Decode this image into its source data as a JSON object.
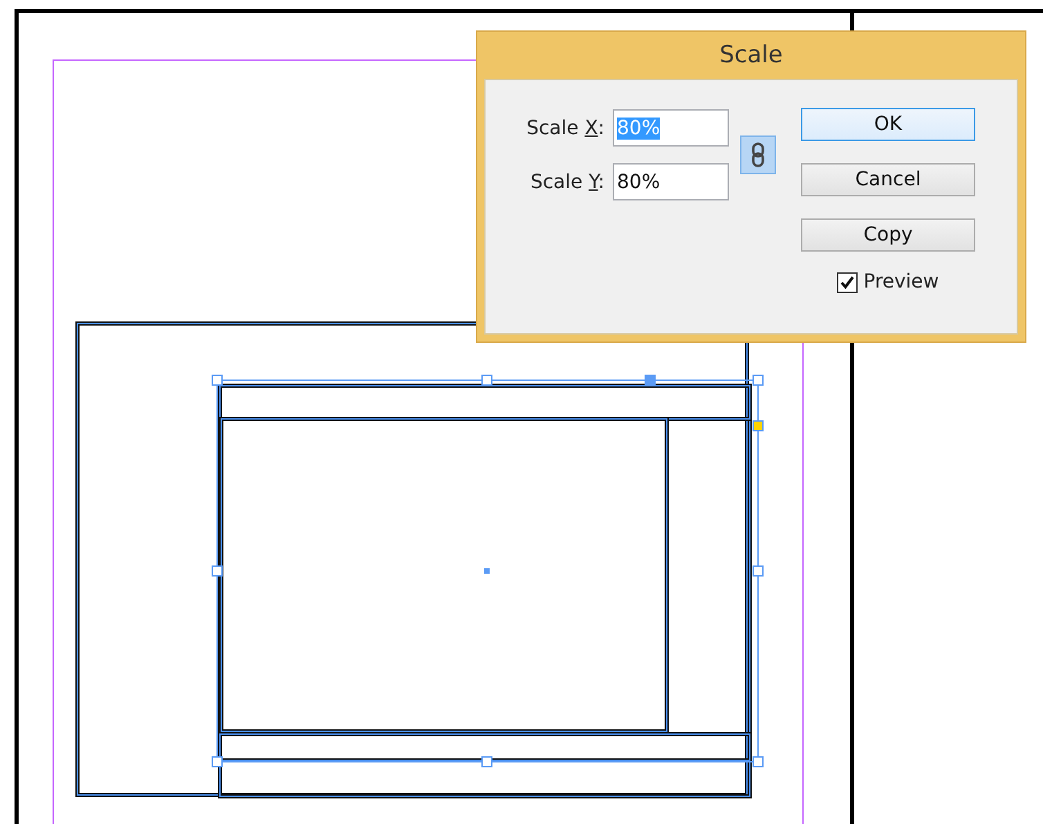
{
  "dialog": {
    "title": "Scale",
    "fields": [
      {
        "label_before": "Scale ",
        "access_key": "X",
        "label_after": ":",
        "value": "80%",
        "value_selected": true
      },
      {
        "label_before": "Scale ",
        "access_key": "Y",
        "label_after": ":",
        "value": "80%",
        "value_selected": false
      }
    ],
    "constrain_link": {
      "on": true
    },
    "buttons": [
      {
        "label": "OK",
        "default": true
      },
      {
        "label": "Cancel",
        "default": false
      },
      {
        "label": "Copy",
        "default": false
      }
    ],
    "preview": {
      "label": "Preview",
      "checked": true
    }
  }
}
